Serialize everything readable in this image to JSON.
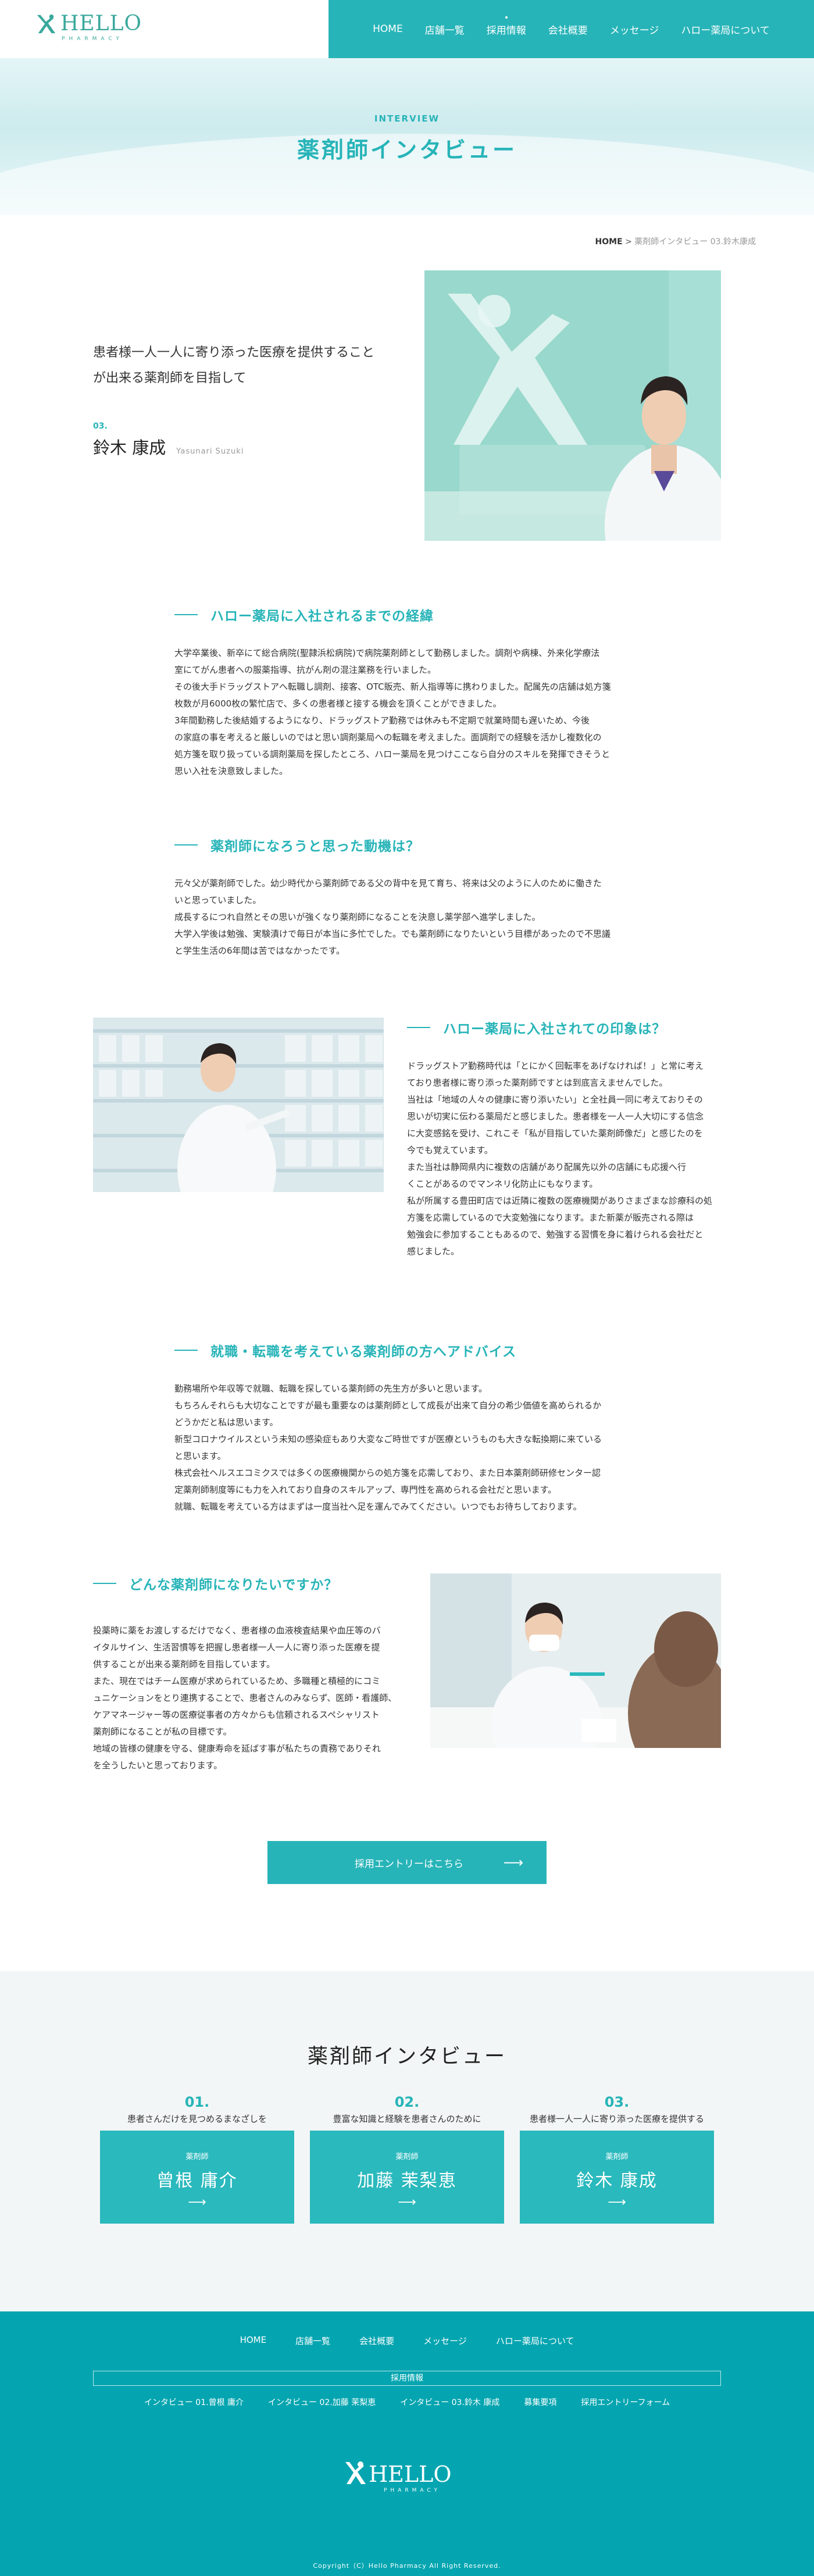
{
  "header": {
    "logo_word": "HELLO",
    "logo_sub": "PHARMACY",
    "nav": [
      "HOME",
      "店舗一覧",
      "採用情報",
      "会社概要",
      "メッセージ",
      "ハロー薬局について"
    ]
  },
  "hero": {
    "kicker": "INTERVIEW",
    "title": "薬剤師インタビュー"
  },
  "breadcrumb": {
    "home": "HOME",
    "sep": ">",
    "current": "薬剤師インタビュー 03.鈴木康成"
  },
  "profile": {
    "lead_line1": "患者様一人一人に寄り添った医療を提供すること",
    "lead_line2": "が出来る薬剤師を目指して",
    "num": "03.",
    "name": "鈴木 康成",
    "name_en": "Yasunari Suzuki"
  },
  "sections": [
    {
      "title": "ハロー薬局に入社されるまでの経緯",
      "body": "大学卒業後、新卒にて総合病院(聖隷浜松病院)で病院薬剤師として勤務しました。調剤や病棟、外来化学療法\n室にてがん患者への服薬指導、抗がん剤の混注業務を行いました。\nその後大手ドラッグストアへ転職し調剤、接客、OTC販売、新人指導等に携わりました。配属先の店舗は処方箋\n枚数が月6000枚の繁忙店で、多くの患者様と接する機会を頂くことができました。\n3年間勤務した後結婚するようになり、ドラッグストア勤務では休みも不定期で就業時間も遅いため、今後\nの家庭の事を考えると厳しいのではと思い調剤薬局への転職を考えました。面調剤での経験を活かし複数化の\n処方箋を取り扱っている調剤薬局を探したところ、ハロー薬局を見つけここなら自分のスキルを発揮できそうと\n思い入社を決意致しました。"
    },
    {
      "title": "薬剤師になろうと思った動機は？",
      "body": "元々父が薬剤師でした。幼少時代から薬剤師である父の背中を見て育ち、将来は父のように人のために働きた\nいと思っていました。\n成長するにつれ自然とその思いが強くなり薬剤師になることを決意し薬学部へ進学しました。\n大学入学後は勉強、実験漬けで毎日が本当に多忙でした。でも薬剤師になりたいという目標があったので不思議\nと学生生活の6年間は苦ではなかったです。"
    },
    {
      "title": "ハロー薬局に入社されての印象は？",
      "body": "ドラッグストア勤務時代は「とにかく回転率をあげなければ！」と常に考え\nており患者様に寄り添った薬剤師ですとは到底言えませんでした。\n当社は「地域の人々の健康に寄り添いたい」と全社員一同に考えておりその\n思いが切実に伝わる薬局だと感じました。患者様を一人一人大切にする信念\nに大変感銘を受け、これこそ「私が目指していた薬剤師像だ」と感じたのを\n今でも覚えています。\nまた当社は静岡県内に複数の店舗があり配属先以外の店舗にも応援へ行\nくことがあるのでマンネリ化防止にもなります。\n私が所属する豊田町店では近隣に複数の医療機関がありさまざまな診療科の処\n方箋を応需しているので大変勉強になります。また新薬が販売される際は\n勉強会に参加することもあるので、勉強する習慣を身に着けられる会社だと\n感じました。"
    },
    {
      "title": "就職・転職を考えている薬剤師の方へアドバイス",
      "body": "勤務場所や年収等で就職、転職を探している薬剤師の先生方が多いと思います。\nもちろんそれらも大切なことですが最も重要なのは薬剤師として成長が出来て自分の希少価値を高められるか\nどうかだと私は思います。\n新型コロナウイルスという未知の感染症もあり大変なご時世ですが医療というものも大きな転換期に来ている\nと思います。\n株式会社ヘルスエコミクスでは多くの医療機関からの処方箋を応需しており、また日本薬剤師研修センター認\n定薬剤師制度等にも力を入れており自身のスキルアップ、専門性を高められる会社だと思います。\n就職、転職を考えている方はまずは一度当社へ足を運んでみてください。いつでもお待ちしております。"
    },
    {
      "title": "どんな薬剤師になりたいですか？",
      "body": "投薬時に薬をお渡しするだけでなく、患者様の血液検査結果や血圧等のバ\nイタルサイン、生活習慣等を把握し患者様一人一人に寄り添った医療を提\n供することが出来る薬剤師を目指しています。\nまた、現在ではチーム医療が求められているため、多職種と積極的にコミ\nュニケーションをとり連携することで、患者さんのみならず、医師・看護師、\nケアマネージャー等の医療従事者の方々からも信頼されるスペシャリスト\n薬剤師になることが私の目標です。\n地域の皆様の健康を守る、健康寿命を延ばす事が私たちの責務でありそれ\nを全うしたいと思っております。"
    }
  ],
  "cta": {
    "label": "採用エントリーはこちら",
    "arrow": "⟶"
  },
  "others": {
    "title": "薬剤師インタビュー",
    "cards": [
      {
        "num": "01.",
        "caption": "患者さんだけを見つめるまなざしを",
        "role": "薬剤師",
        "name": "曾根 庸介",
        "arrow": "⟶"
      },
      {
        "num": "02.",
        "caption": "豊富な知識と経験を患者さんのために",
        "role": "薬剤師",
        "name": "加藤 茉梨恵",
        "arrow": "⟶"
      },
      {
        "num": "03.",
        "caption": "患者様一人一人に寄り添った医療を提供する",
        "role": "薬剤師",
        "name": "鈴木 康成",
        "arrow": "⟶"
      }
    ]
  },
  "footer": {
    "nav": [
      "HOME",
      "店舗一覧",
      "会社概要",
      "メッセージ",
      "ハロー薬局について"
    ],
    "recruit_label": "採用情報",
    "sub": [
      "インタビュー 01.曾根 庸介",
      "インタビュー 02.加藤 茉梨恵",
      "インタビュー 03.鈴木 康成",
      "募集要項",
      "採用エントリーフォーム"
    ],
    "logo_word": "HELLO",
    "logo_sub": "PHARMACY",
    "copyright": "Copyright（C）Hello Pharmacy All Right Reserved."
  },
  "colors": {
    "accent": "#27b4b8",
    "footer_bg": "#04a5b0",
    "logo_green": "#3aa89c"
  }
}
